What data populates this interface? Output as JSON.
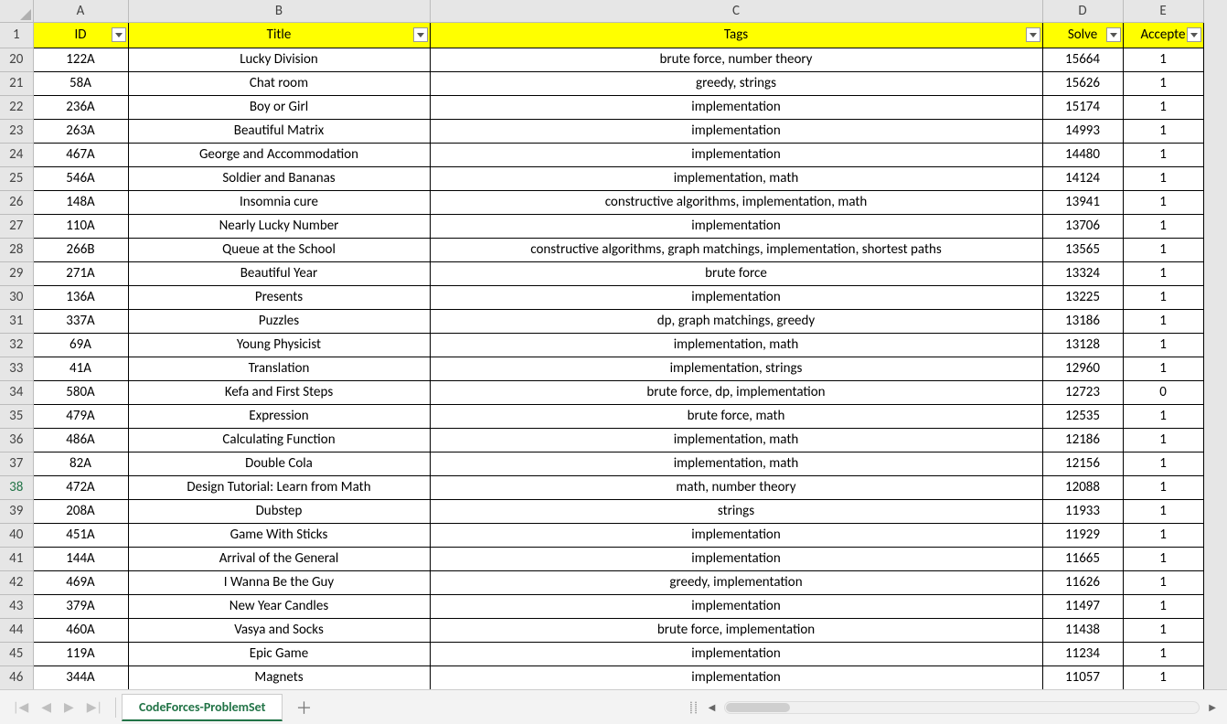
{
  "columns": {
    "letters": [
      "A",
      "B",
      "C",
      "D",
      "E"
    ],
    "headers": [
      "ID",
      "Title",
      "Tags",
      "Solve",
      "Accepte"
    ]
  },
  "firstRowNum": 1,
  "rowNums": [
    20,
    21,
    22,
    23,
    24,
    25,
    26,
    27,
    28,
    29,
    30,
    31,
    32,
    33,
    34,
    35,
    36,
    37,
    38,
    39,
    40,
    41,
    42,
    43,
    44,
    45,
    46
  ],
  "selectedRow": 38,
  "rows": [
    {
      "id": "122A",
      "title": "Lucky Division",
      "tags": "brute force, number theory",
      "solved": "15664",
      "accepted": "1"
    },
    {
      "id": "58A",
      "title": "Chat room",
      "tags": "greedy, strings",
      "solved": "15626",
      "accepted": "1"
    },
    {
      "id": "236A",
      "title": "Boy or Girl",
      "tags": "implementation",
      "solved": "15174",
      "accepted": "1"
    },
    {
      "id": "263A",
      "title": "Beautiful Matrix",
      "tags": "implementation",
      "solved": "14993",
      "accepted": "1"
    },
    {
      "id": "467A",
      "title": "George and Accommodation",
      "tags": "implementation",
      "solved": "14480",
      "accepted": "1"
    },
    {
      "id": "546A",
      "title": "Soldier and Bananas",
      "tags": "implementation, math",
      "solved": "14124",
      "accepted": "1"
    },
    {
      "id": "148A",
      "title": "Insomnia cure",
      "tags": "constructive algorithms, implementation, math",
      "solved": "13941",
      "accepted": "1"
    },
    {
      "id": "110A",
      "title": "Nearly Lucky Number",
      "tags": "implementation",
      "solved": "13706",
      "accepted": "1"
    },
    {
      "id": "266B",
      "title": "Queue at the School",
      "tags": "constructive algorithms, graph matchings, implementation, shortest paths",
      "solved": "13565",
      "accepted": "1"
    },
    {
      "id": "271A",
      "title": "Beautiful Year",
      "tags": "brute force",
      "solved": "13324",
      "accepted": "1"
    },
    {
      "id": "136A",
      "title": "Presents",
      "tags": "implementation",
      "solved": "13225",
      "accepted": "1"
    },
    {
      "id": "337A",
      "title": "Puzzles",
      "tags": "dp, graph matchings, greedy",
      "solved": "13186",
      "accepted": "1"
    },
    {
      "id": "69A",
      "title": "Young Physicist",
      "tags": "implementation, math",
      "solved": "13128",
      "accepted": "1"
    },
    {
      "id": "41A",
      "title": "Translation",
      "tags": "implementation, strings",
      "solved": "12960",
      "accepted": "1"
    },
    {
      "id": "580A",
      "title": "Kefa and First Steps",
      "tags": "brute force, dp, implementation",
      "solved": "12723",
      "accepted": "0"
    },
    {
      "id": "479A",
      "title": "Expression",
      "tags": "brute force, math",
      "solved": "12535",
      "accepted": "1"
    },
    {
      "id": "486A",
      "title": "Calculating Function",
      "tags": "implementation, math",
      "solved": "12186",
      "accepted": "1"
    },
    {
      "id": "82A",
      "title": "Double Cola",
      "tags": "implementation, math",
      "solved": "12156",
      "accepted": "1"
    },
    {
      "id": "472A",
      "title": "Design Tutorial: Learn from Math",
      "tags": "math, number theory",
      "solved": "12088",
      "accepted": "1"
    },
    {
      "id": "208A",
      "title": "Dubstep",
      "tags": "strings",
      "solved": "11933",
      "accepted": "1"
    },
    {
      "id": "451A",
      "title": "Game With Sticks",
      "tags": "implementation",
      "solved": "11929",
      "accepted": "1"
    },
    {
      "id": "144A",
      "title": "Arrival of the General",
      "tags": "implementation",
      "solved": "11665",
      "accepted": "1"
    },
    {
      "id": "469A",
      "title": "I Wanna Be the Guy",
      "tags": "greedy, implementation",
      "solved": "11626",
      "accepted": "1"
    },
    {
      "id": "379A",
      "title": "New Year Candles",
      "tags": "implementation",
      "solved": "11497",
      "accepted": "1"
    },
    {
      "id": "460A",
      "title": "Vasya and Socks",
      "tags": "brute force, implementation",
      "solved": "11438",
      "accepted": "1"
    },
    {
      "id": "119A",
      "title": "Epic Game",
      "tags": "implementation",
      "solved": "11234",
      "accepted": "1"
    },
    {
      "id": "344A",
      "title": "Magnets",
      "tags": "implementation",
      "solved": "11057",
      "accepted": "1"
    }
  ],
  "sheetTab": "CodeForces-ProblemSet",
  "navGlyphs": {
    "first": "|◀",
    "prev": "◀",
    "next": "▶",
    "last": "▶|"
  },
  "addSheetGlyph": "＋",
  "scrollSplitGlyph": "⸽⸽",
  "scrollLeftGlyph": "◀",
  "scrollRightGlyph": "▶"
}
